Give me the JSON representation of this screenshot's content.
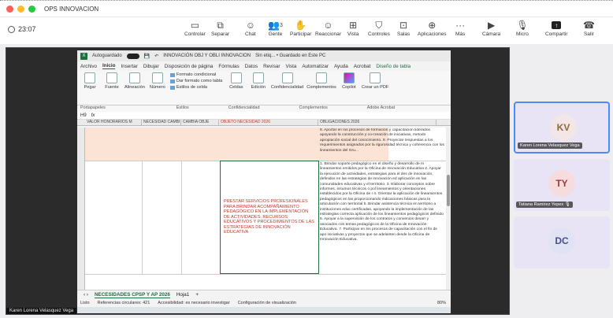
{
  "window": {
    "title": "OPS INNOVACION"
  },
  "meeting": {
    "elapsed": "23:07"
  },
  "toolbar": {
    "controlar": "Controlar",
    "separar": "Separar",
    "chat": "Chat",
    "gente": "Gente",
    "gente_count": "3",
    "participar": "Participar",
    "reaccionar": "Reaccionar",
    "vista": "Vista",
    "controles": "Controles",
    "salas": "Salas",
    "aplicaciones": "Aplicaciones",
    "mas": "Más",
    "camara": "Cámara",
    "micro": "Micro",
    "compartir": "Compartir",
    "salir": "Salir"
  },
  "excel": {
    "autosave": "Autoguardado",
    "doc_title": "INNOVACIÓN OBJ Y OBLI INNOVACION",
    "doc_status": "Sin etiq... • Guardado en Este PC",
    "tabs": [
      "Archivo",
      "Inicio",
      "Insertar",
      "Dibujar",
      "Disposición de página",
      "Fórmulas",
      "Datos",
      "Revisar",
      "Vista",
      "Automatizar",
      "Ayuda",
      "Acrobat",
      "Diseño de tabla"
    ],
    "ribbon": {
      "pegar": "Pegar",
      "fuente": "Fuente",
      "alineacion": "Alineación",
      "numero": "Número",
      "formato_condicional": "Formato condicional",
      "dar_formato": "Dar formato como tabla",
      "estilos_celda": "Estilos de celda",
      "celdas": "Celdas",
      "edicion": "Edición",
      "confidencialidad": "Confidencialidad",
      "complementos": "Complementos",
      "copilot": "Copilot",
      "crear_pdf": "Crear un PDF",
      "portapapeles": "Portapapeles",
      "estilos": "Estilos",
      "grp_confidencialidad": "Confidencialidad",
      "grp_complementos": "Complementos",
      "adobe": "Adobe Acrobat"
    },
    "namebox": "H9",
    "fx": "fx",
    "columns": [
      "VALOR HONORARIOS M",
      "NECESIDAD CAMBI",
      "CAMBIA OBJE",
      "OBJETO NECESIDAD 2026",
      "OBLIGACIONES 2026"
    ],
    "peach_text": "8. Aportar en los procesos de formación y capacitación liderados apoyando la construcción y co-creación de iniciativas, metodo apropiación social del conocimiento. 9. Proyectar respuestas a los requerimientos asignados por la rigurosidad técnica y coherencia con los lineamientos del Gru...",
    "selected_cell": "PRESTAR SERVICIOS PROFESIONALES PARA BRINDAR ACOMPAÑAMIENTO PEDAGÓGICO EN LA IMPLEMENTACIÓN DE ACTIVIDADES, RECURSOS EDUCATIVOS Y PROCEDIMIENTOS DE LAS ESTRATEGIAS DE INNOVACIÓN EDUCATIVA",
    "obligations": "1. Brindar soporte pedagógico en el diseño y desarrollo de m lineamientos emitidos por la Oficina de Innovación Educativa 2. Apoyar la ejecución de actividades, estrategias para el des de innovación, definidos en las estrategias de innovación ed aplicación en las comunidades educativas y el territorio. 3. Elaborar conceptos sobre informes, insumos técnicos o pol lineamientos y orientaciones establecidos por la Oficina de I 4. Orientar la aplicación de lineamientos pedagógicos en las proporcionando indicaciones básicas para la articulación con territorial 5. Brindar asistencia técnica en territorio a instituciones educ certificadas, apoyando la implementación de las estrategias correcta aplicación de los lineamientos pedagógicos definido 6. Apoyar a la supervisión de los contratos y convenios desarr y asociados con temas pedagógicos de la Oficina de Innovación Educativa. 7. Participar en los procesos de capacitación con el fin de apo iniciativas y proyectos que se adelanten desde la Oficina de Innovación Educativa.",
    "sheet_tabs": [
      "NECESIDADES CPSP Y AP 2026",
      "Hoja1"
    ],
    "status": {
      "listo": "Listo",
      "refs": "Referencias circulares: 421",
      "accesibilidad": "Accesibilidad: es necesario investigar",
      "config": "Configuración de visualización",
      "zoom": "80%"
    }
  },
  "participants": [
    {
      "initials": "KV",
      "name": "Karen Lorena Velasquez Vega",
      "bg": "#f3e6e6",
      "fg": "#8a6a3a",
      "speaking": true
    },
    {
      "initials": "TY",
      "name": "Tatiana Ramirez Yepes",
      "bg": "#f6dcdc",
      "fg": "#9b3a3a",
      "speaking": false
    },
    {
      "initials": "DC",
      "name": "",
      "bg": "#dfe3f3",
      "fg": "#46508a",
      "speaking": false
    }
  ],
  "presenter": {
    "name": "Karen Lorena Velasquez Vega"
  }
}
